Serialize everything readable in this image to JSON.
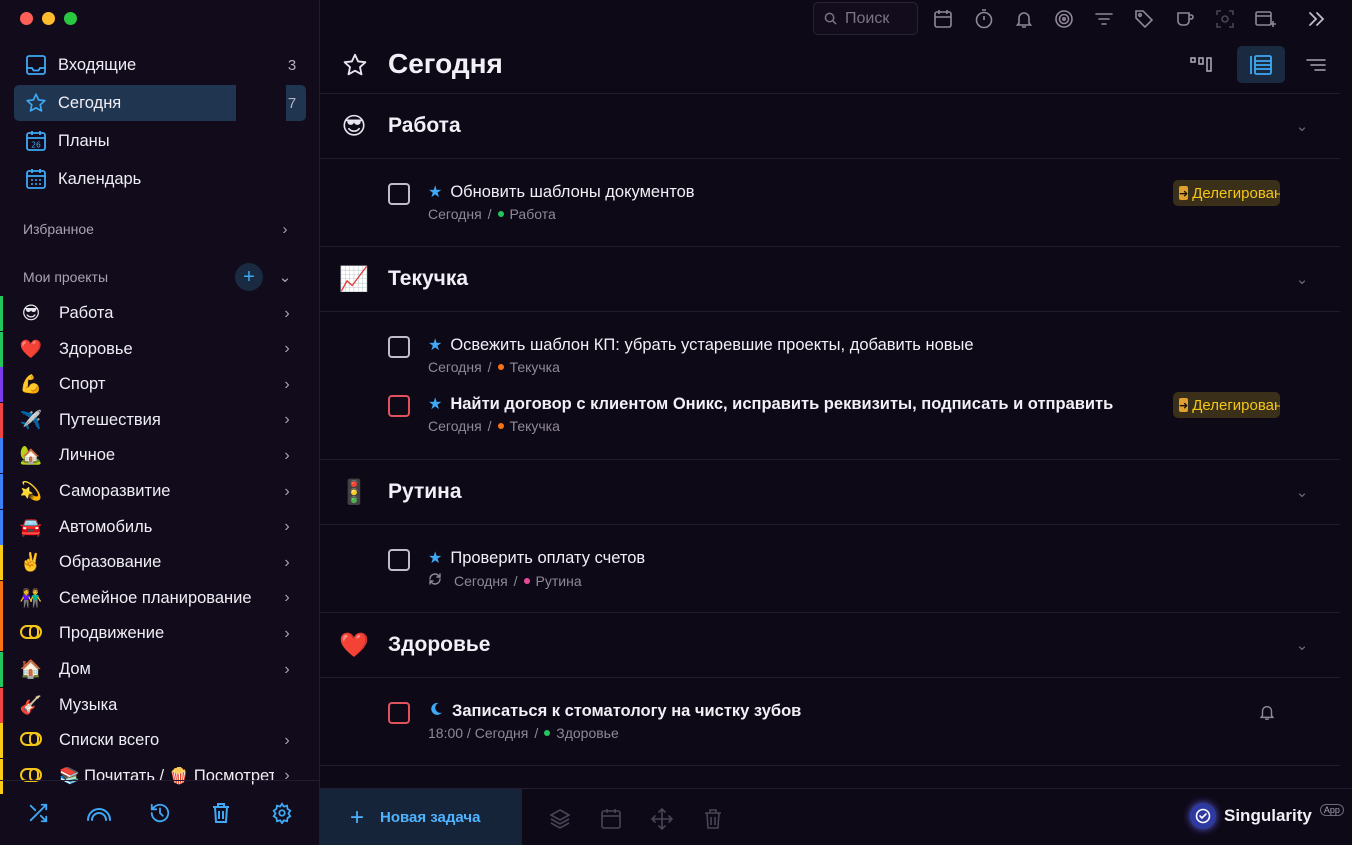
{
  "window": {
    "traffic_colors": [
      "#ff5f57",
      "#febc2e",
      "#28c840"
    ]
  },
  "sidebar": {
    "nav": [
      {
        "label": "Входящие",
        "count": "3",
        "icon": "inbox-icon"
      },
      {
        "label": "Сегодня",
        "count": "7",
        "icon": "star-icon"
      },
      {
        "label": "Планы",
        "count": "",
        "icon": "calendar-26-icon"
      },
      {
        "label": "Календарь",
        "count": "",
        "icon": "calendar-grid-icon"
      }
    ],
    "favorites_label": "Избранное",
    "projects_label": "Мои проекты",
    "projects": [
      {
        "emoji": "😎",
        "label": "Работа",
        "color": "#22c55e"
      },
      {
        "emoji": "❤️",
        "label": "Здоровье",
        "color": "#22c55e"
      },
      {
        "emoji": "💪",
        "label": "Спорт",
        "color": "#7c3aed"
      },
      {
        "emoji": "✈️",
        "label": "Путешествия",
        "color": "#ef4444"
      },
      {
        "emoji": "🏡",
        "label": "Личное",
        "color": "#3b82f6"
      },
      {
        "emoji": "💫",
        "label": "Саморазвитие",
        "color": "#3b82f6"
      },
      {
        "emoji": "🚘",
        "label": "Автомобиль",
        "color": "#3b82f6"
      },
      {
        "emoji": "✌️",
        "label": "Образование",
        "color": "#facc15"
      },
      {
        "emoji": "👫",
        "label": "Семейное планирование",
        "color": "#f97316"
      },
      {
        "emoji": "",
        "label": "Продвижение",
        "color": "#f97316"
      },
      {
        "emoji": "🏠",
        "label": "Дом",
        "color": "#22c55e"
      },
      {
        "emoji": "🎸",
        "label": "Музыка",
        "color": "#ef4444"
      },
      {
        "emoji": "",
        "label": "Списки всего",
        "color": "#facc15"
      },
      {
        "emoji": "",
        "label": "📚 Почитать / 🍿 Посмотреть",
        "color": "#facc15"
      }
    ]
  },
  "toolbar": {
    "search_placeholder": "Поиск"
  },
  "header": {
    "title": "Сегодня"
  },
  "groups": [
    {
      "emoji": "😎",
      "title": "Работа"
    },
    {
      "emoji": "📈",
      "title": "Текучка"
    },
    {
      "emoji": "🚦",
      "title": "Рутина"
    },
    {
      "emoji": "❤️",
      "title": "Здоровье"
    }
  ],
  "tasks": [
    {
      "title": "Обновить шаблоны документов",
      "date": "Сегодня",
      "project": "Работа",
      "dot": "#22c55e",
      "badge": "Делегировано"
    },
    {
      "title": "Освежить шаблон КП: убрать устаревшие проекты, добавить новые",
      "date": "Сегодня",
      "project": "Текучка",
      "dot": "#f97316"
    },
    {
      "title": "Найти договор с клиентом Оникс, исправить реквизиты, подписать и отправить",
      "date": "Сегодня",
      "project": "Текучка",
      "dot": "#f97316",
      "badge": "Делегировано"
    },
    {
      "title": "Проверить оплату счетов",
      "date": "Сегодня",
      "project": "Рутина",
      "dot": "#ec4899"
    },
    {
      "title": "Записаться к стоматологу на чистку зубов",
      "date": "18:00 / Сегодня",
      "project": "Здоровье",
      "dot": "#22c55e"
    }
  ],
  "footer": {
    "new_task": "Новая задача",
    "brand": "Singularity",
    "brand_tag": "App"
  }
}
